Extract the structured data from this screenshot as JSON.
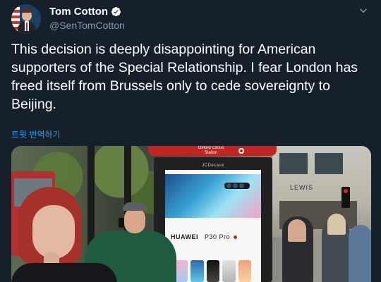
{
  "author": {
    "display_name": "Tom Cotton",
    "handle": "@SenTomCotton",
    "verified": true,
    "avatar_icon": "profile-photo",
    "verified_icon": "verified-badge-icon"
  },
  "tweet": {
    "text": "This decision is deeply disappointing for American supporters of the Special Relationship. I fear London has freed itself from Brussels only to cede sovereignty to Beijing.",
    "translate_label": "트윗 번역하기"
  },
  "menu": {
    "icon": "chevron-down-icon"
  },
  "media": {
    "station_sign": "Oxford Circus\nStation",
    "kiosk_brand": "JCDecaux",
    "ad_brand": "HUAWEI",
    "ad_model": "P30 Pro",
    "shop_sign": "LEWIS"
  },
  "colors": {
    "background": "#15202b",
    "text": "#ffffff",
    "secondary_text": "#8899a6",
    "link": "#1da1f2",
    "verified": "#ffffff"
  }
}
